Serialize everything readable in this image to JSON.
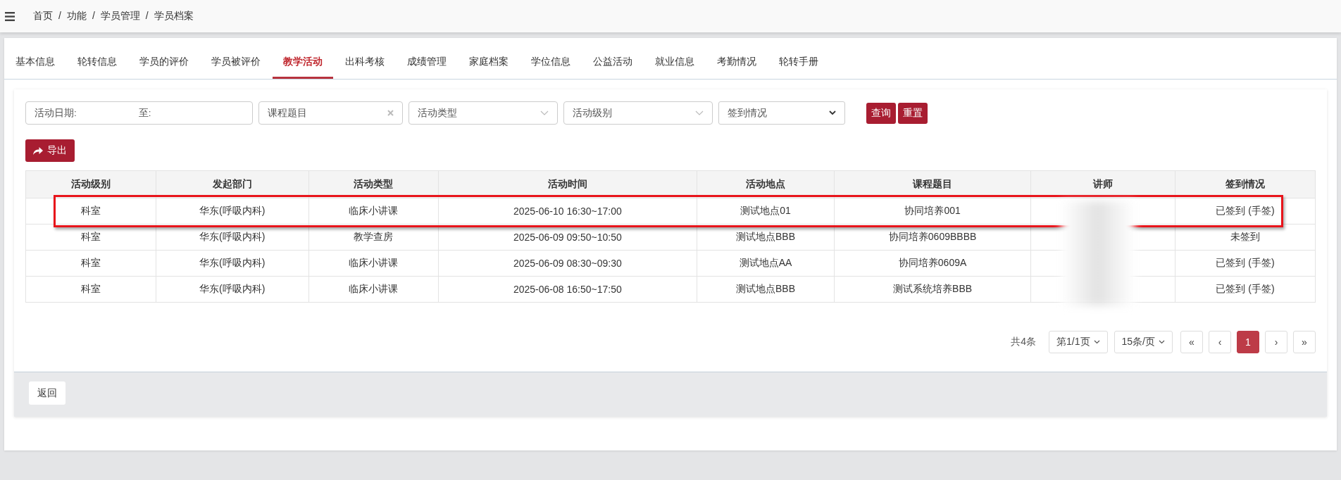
{
  "breadcrumb": {
    "separator": "/",
    "items": [
      "首页",
      "功能",
      "学员管理",
      "学员档案"
    ]
  },
  "tabs": [
    {
      "label": "基本信息",
      "selected": false
    },
    {
      "label": "轮转信息",
      "selected": false
    },
    {
      "label": "学员的评价",
      "selected": false
    },
    {
      "label": "学员被评价",
      "selected": false
    },
    {
      "label": "教学活动",
      "selected": true
    },
    {
      "label": "出科考核",
      "selected": false
    },
    {
      "label": "成绩管理",
      "selected": false
    },
    {
      "label": "家庭档案",
      "selected": false
    },
    {
      "label": "学位信息",
      "selected": false
    },
    {
      "label": "公益活动",
      "selected": false
    },
    {
      "label": "就业信息",
      "selected": false
    },
    {
      "label": "考勤情况",
      "selected": false
    },
    {
      "label": "轮转手册",
      "selected": false
    }
  ],
  "filters": {
    "date_label": "活动日期:",
    "date_to_label": "至:",
    "topic_placeholder": "课程题目",
    "type_placeholder": "活动类型",
    "level_placeholder": "活动级别",
    "checkin_value": "签到情况",
    "query_button": "查询",
    "reset_button": "重置"
  },
  "export_button": "导出",
  "table": {
    "columns": [
      "活动级别",
      "发起部门",
      "活动类型",
      "活动时间",
      "活动地点",
      "课程题目",
      "讲师",
      "签到情况"
    ],
    "rows": [
      {
        "highlighted": true,
        "cells": [
          "科室",
          "华东(呼吸内科)",
          "临床小讲课",
          "2025-06-10  16:30~17:00",
          "测试地点01",
          "协同培养001",
          "",
          "已签到 (手签)"
        ]
      },
      {
        "highlighted": false,
        "cells": [
          "科室",
          "华东(呼吸内科)",
          "教学查房",
          "2025-06-09  09:50~10:50",
          "测试地点BBB",
          "协同培养0609BBBB",
          "",
          "未签到"
        ]
      },
      {
        "highlighted": false,
        "cells": [
          "科室",
          "华东(呼吸内科)",
          "临床小讲课",
          "2025-06-09  08:30~09:30",
          "测试地点AA",
          "协同培养0609A",
          "",
          "已签到 (手签)"
        ]
      },
      {
        "highlighted": false,
        "cells": [
          "科室",
          "华东(呼吸内科)",
          "临床小讲课",
          "2025-06-08  16:50~17:50",
          "测试地点BBB",
          "测试系统培养BBB",
          "",
          "已签到 (手签)"
        ]
      }
    ]
  },
  "pagination": {
    "total": "共4条",
    "page_select": "第1/1页",
    "size_select": "15条/页",
    "first": "«",
    "prev": "‹",
    "pages": [
      {
        "label": "1",
        "selected": true
      }
    ],
    "next": "›",
    "last": "»"
  },
  "footer": {
    "back_button": "返回"
  }
}
